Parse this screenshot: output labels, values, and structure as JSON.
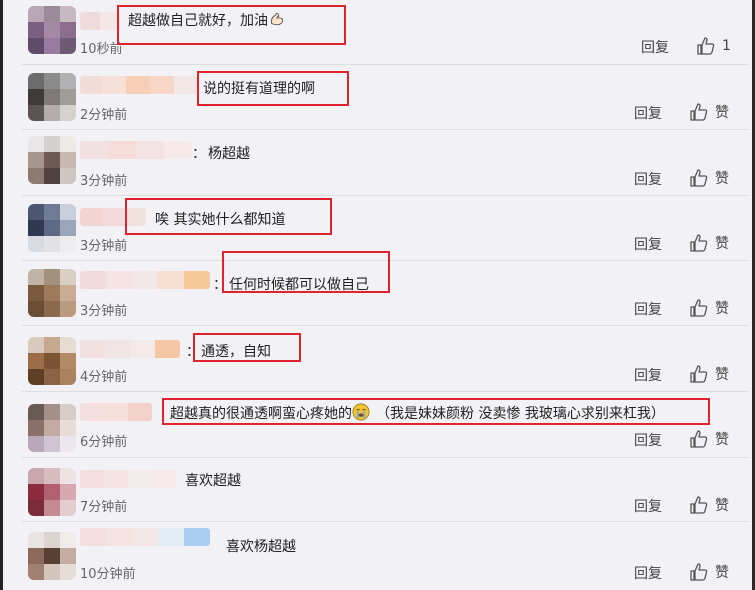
{
  "comments": [
    {
      "text": "超越做自己就好，加油",
      "time": "10秒前",
      "reply": "回复",
      "like": "1",
      "emoji": "muscle",
      "colon": false
    },
    {
      "text": "说的挺有道理的啊",
      "time": "2分钟前",
      "reply": "回复",
      "like": "赞",
      "colon": false
    },
    {
      "text": "杨超越",
      "time": "3分钟前",
      "reply": "回复",
      "like": "赞",
      "colon": true
    },
    {
      "text": "唉 其实她什么都知道",
      "time": "3分钟前",
      "reply": "回复",
      "like": "赞",
      "colon": false
    },
    {
      "text": "任何时候都可以做自己",
      "time": "3分钟前",
      "reply": "回复",
      "like": "赞",
      "colon": true
    },
    {
      "text": "通透，自知",
      "time": "4分钟前",
      "reply": "回复",
      "like": "赞",
      "colon": true
    },
    {
      "text": "超越真的很通透啊蛮心疼她的",
      "text2": "（我是妹妹颜粉 没卖惨 我玻璃心求别来杠我）",
      "time": "6分钟前",
      "reply": "回复",
      "like": "赞",
      "emoji": "crying",
      "colon": false
    },
    {
      "text": "喜欢超越",
      "time": "7分钟前",
      "reply": "回复",
      "like": "赞",
      "colon": false
    },
    {
      "text": "喜欢杨超越",
      "time": "10分钟前",
      "reply": "回复",
      "like": "赞",
      "colon": false
    }
  ],
  "colon_char": "：",
  "colors": {
    "highlight_box": "#e0242f",
    "background": "#f2f1f5"
  }
}
